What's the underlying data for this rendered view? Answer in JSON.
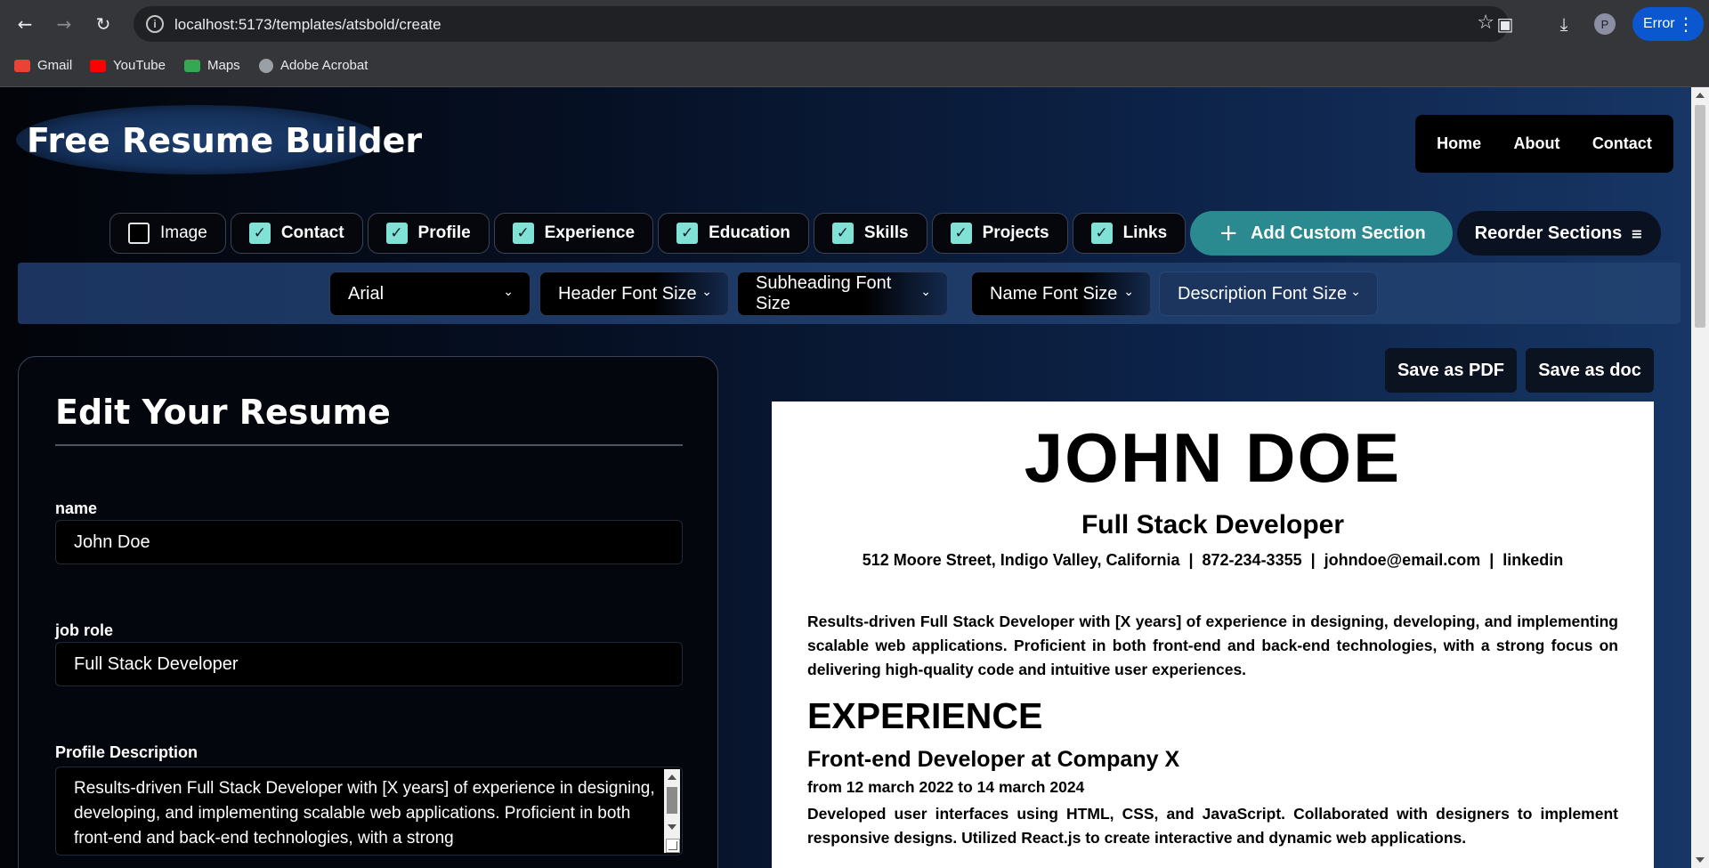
{
  "browser": {
    "url": "localhost:5173/templates/atsbold/create",
    "profile_initial": "P",
    "error_label": "Error",
    "bookmarks": [
      {
        "label": "Gmail",
        "icon": "gmail-icon",
        "color": "#ea4335"
      },
      {
        "label": "YouTube",
        "icon": "youtube-icon",
        "color": "#ff0000"
      },
      {
        "label": "Maps",
        "icon": "maps-icon",
        "color": "#34a853"
      },
      {
        "label": "Adobe Acrobat",
        "icon": "globe-icon",
        "color": "#9aa0a6"
      }
    ]
  },
  "header": {
    "brand": "Free Resume Builder",
    "nav": [
      "Home",
      "About",
      "Contact"
    ]
  },
  "sections": [
    {
      "label": "Image",
      "checked": false
    },
    {
      "label": "Contact",
      "checked": true
    },
    {
      "label": "Profile",
      "checked": true
    },
    {
      "label": "Experience",
      "checked": true
    },
    {
      "label": "Education",
      "checked": true
    },
    {
      "label": "Skills",
      "checked": true
    },
    {
      "label": "Projects",
      "checked": true
    },
    {
      "label": "Links",
      "checked": true
    }
  ],
  "actions": {
    "add_custom": "Add Custom Section",
    "reorder": "Reorder Sections"
  },
  "fonts": {
    "family": "Arial",
    "header_size": "Header Font Size",
    "subheading_size": "Subheading Font Size",
    "name_size": "Name Font Size",
    "description_size": "Description Font Size"
  },
  "editor": {
    "title": "Edit Your Resume",
    "name_label": "name",
    "name_value": "John Doe",
    "role_label": "job role",
    "role_value": "Full Stack Developer",
    "profile_label": "Profile Description",
    "profile_value": "Results-driven Full Stack Developer with [X years] of experience in designing, developing, and implementing scalable web applications. Proficient in both front-end and back-end technologies, with a strong"
  },
  "export": {
    "pdf": "Save as PDF",
    "doc": "Save as doc"
  },
  "preview": {
    "name": "JOHN DOE",
    "role": "Full Stack Developer",
    "contact": "512 Moore Street, Indigo Valley, California  |  872-234-3355  |  johndoe@email.com  |  linkedin",
    "summary": "Results-driven Full Stack Developer with [X years] of experience in designing, developing, and implementing scalable web applications. Proficient in both front-end and back-end technologies, with a strong focus on delivering high-quality code and intuitive user experiences.",
    "section_title": "EXPERIENCE",
    "job_title": "Front-end Developer at Company X",
    "job_dates": "from 12 march 2022 to 14 march 2024",
    "job_description": "Developed user interfaces using HTML, CSS, and JavaScript. Collaborated with designers to implement responsive designs. Utilized React.js to create interactive and dynamic web applications."
  },
  "colors": {
    "accent": "#2b8a8f",
    "checkbox": "#7fe2d4",
    "chrome": "#35363a"
  }
}
